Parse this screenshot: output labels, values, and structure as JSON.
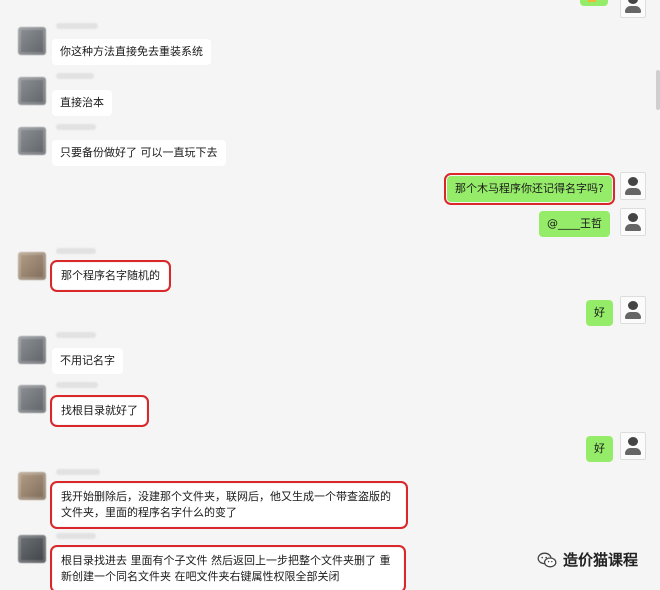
{
  "messages": [
    {
      "side": "left",
      "text": "你这种方法直接免去重装系统"
    },
    {
      "side": "left",
      "text": "直接治本"
    },
    {
      "side": "left",
      "text": "只要备份做好了  可以一直玩下去"
    },
    {
      "side": "right",
      "text": "那个木马程序你还记得名字吗?",
      "highlight": true
    },
    {
      "side": "right",
      "text": "@____王哲"
    },
    {
      "side": "left",
      "text": "那个程序名字随机的",
      "highlight": true
    },
    {
      "side": "right",
      "text": "好"
    },
    {
      "side": "left",
      "text": "不用记名字"
    },
    {
      "side": "left",
      "text": "找根目录就好了",
      "highlight": true
    },
    {
      "side": "right",
      "text": "好"
    },
    {
      "side": "left",
      "text": "我开始删除后，没建那个文件夹，联网后，他又生成一个带查盗版的文件夹，里面的程序名字什么的变了",
      "highlight": true
    },
    {
      "side": "left",
      "text": "根目录找进去  里面有个子文件  然后返回上一步把整个文件夹删了  重新创建一个同名文件夹  在吧文件夹右键属性权限全部关闭",
      "highlight": true
    }
  ],
  "watermark": {
    "text": "造价猫课程"
  },
  "colors": {
    "sent_bubble": "#95ec69",
    "received_bubble": "#ffffff",
    "highlight": "#d9272a",
    "background": "#f5f5f5"
  }
}
